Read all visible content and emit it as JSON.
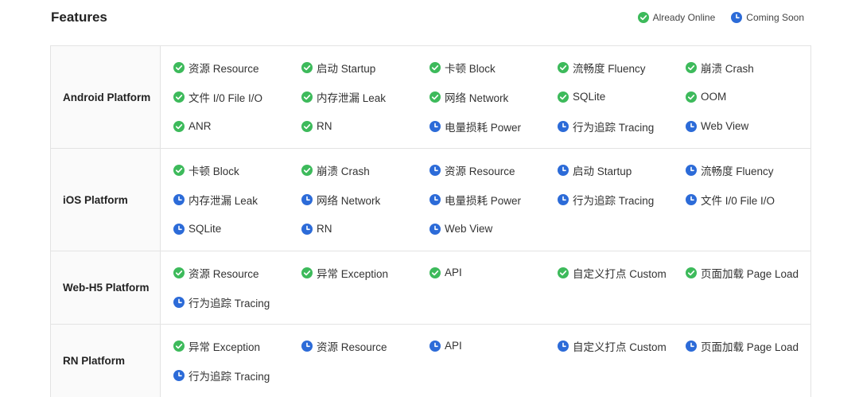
{
  "header": {
    "title": "Features",
    "legend": {
      "online_label": "Already Online",
      "soon_label": "Coming Soon"
    }
  },
  "colors": {
    "online": "#3dba5b",
    "soon": "#2c6bd8"
  },
  "platforms": [
    {
      "name": "Android Platform",
      "features": [
        {
          "label": "资源 Resource",
          "status": "online"
        },
        {
          "label": "启动 Startup",
          "status": "online"
        },
        {
          "label": "卡顿 Block",
          "status": "online"
        },
        {
          "label": "流畅度 Fluency",
          "status": "online"
        },
        {
          "label": "崩溃 Crash",
          "status": "online"
        },
        {
          "label": "文件 I/0 File I/O",
          "status": "online"
        },
        {
          "label": "内存泄漏 Leak",
          "status": "online"
        },
        {
          "label": "网络 Network",
          "status": "online"
        },
        {
          "label": "SQLite",
          "status": "online"
        },
        {
          "label": "OOM",
          "status": "online"
        },
        {
          "label": "ANR",
          "status": "online"
        },
        {
          "label": "RN",
          "status": "online"
        },
        {
          "label": "电量损耗 Power",
          "status": "soon"
        },
        {
          "label": "行为追踪 Tracing",
          "status": "soon"
        },
        {
          "label": "Web View",
          "status": "soon"
        }
      ]
    },
    {
      "name": "iOS Platform",
      "features": [
        {
          "label": "卡顿 Block",
          "status": "online"
        },
        {
          "label": "崩溃 Crash",
          "status": "online"
        },
        {
          "label": "资源 Resource",
          "status": "soon"
        },
        {
          "label": "启动 Startup",
          "status": "soon"
        },
        {
          "label": "流畅度 Fluency",
          "status": "soon"
        },
        {
          "label": "内存泄漏 Leak",
          "status": "soon"
        },
        {
          "label": "网络 Network",
          "status": "soon"
        },
        {
          "label": "电量损耗 Power",
          "status": "soon"
        },
        {
          "label": "行为追踪 Tracing",
          "status": "soon"
        },
        {
          "label": "文件 I/0 File I/O",
          "status": "soon"
        },
        {
          "label": "SQLite",
          "status": "soon"
        },
        {
          "label": "RN",
          "status": "soon"
        },
        {
          "label": "Web View",
          "status": "soon"
        }
      ]
    },
    {
      "name": "Web-H5 Platform",
      "features": [
        {
          "label": "资源 Resource",
          "status": "online"
        },
        {
          "label": "异常 Exception",
          "status": "online"
        },
        {
          "label": "API",
          "status": "online"
        },
        {
          "label": "自定义打点 Custom",
          "status": "online"
        },
        {
          "label": "页面加载 Page Load",
          "status": "online"
        },
        {
          "label": "行为追踪 Tracing",
          "status": "soon"
        }
      ]
    },
    {
      "name": "RN Platform",
      "features": [
        {
          "label": "异常 Exception",
          "status": "online"
        },
        {
          "label": "资源 Resource",
          "status": "soon"
        },
        {
          "label": "API",
          "status": "soon"
        },
        {
          "label": "自定义打点 Custom",
          "status": "soon"
        },
        {
          "label": "页面加载 Page Load",
          "status": "soon"
        },
        {
          "label": "行为追踪 Tracing",
          "status": "soon"
        }
      ]
    }
  ]
}
